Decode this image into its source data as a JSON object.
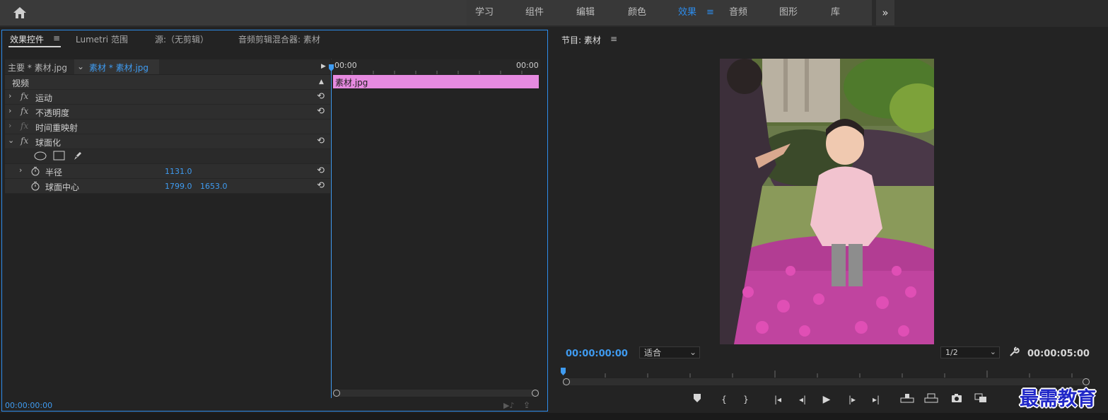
{
  "workspace_tabs": [
    "学习",
    "组件",
    "编辑",
    "颜色",
    "效果",
    "音频",
    "图形",
    "库"
  ],
  "workspace_active": "效果",
  "workspace_menu_glyph": "≡",
  "workspace_more_glyph": "»",
  "left_panel": {
    "tabs": [
      "效果控件",
      "Lumetri 范围",
      "源:（无剪辑）",
      "音频剪辑混合器: 素材"
    ],
    "active_tab_menu": "≡",
    "source_master": "主要 * 素材.jpg",
    "source_clip": "素材 * 素材.jpg",
    "section_video": "视频",
    "effects": [
      {
        "label": "运动",
        "fx": "fx",
        "expand": "›"
      },
      {
        "label": "不透明度",
        "fx": "fx",
        "expand": "›"
      },
      {
        "label": "时间重映射",
        "fx": "fx",
        "expand": "›"
      },
      {
        "label": "球面化",
        "fx": "fx",
        "expand": "⌄"
      }
    ],
    "params": [
      {
        "label": "半径",
        "value1": "1131.0",
        "value2": ""
      },
      {
        "label": "球面中心",
        "value1": "1799.0",
        "value2": "1653.0"
      }
    ],
    "reset_glyph": "⟲",
    "timeline_start": "00:00",
    "timeline_end": "00:00",
    "clip_name": "素材.jpg",
    "footer_time": "00:00:00:00"
  },
  "program": {
    "tab": "节目: 素材",
    "tab_menu": "≡",
    "current_time": "00:00:00:00",
    "zoom": "适合",
    "resolution": "1/2",
    "duration": "00:00:05:00"
  },
  "controls": [
    "marker-icon",
    "mark-in-icon",
    "mark-out-icon",
    "go-to-in-icon",
    "step-back-icon",
    "play-icon",
    "step-forward-icon",
    "go-to-out-icon",
    "lift-icon",
    "extract-icon",
    "export-frame-icon",
    "compare-icon"
  ],
  "watermark": "最需教育",
  "colors": {
    "accent": "#2d8ceb",
    "clip": "#e68ae0"
  }
}
